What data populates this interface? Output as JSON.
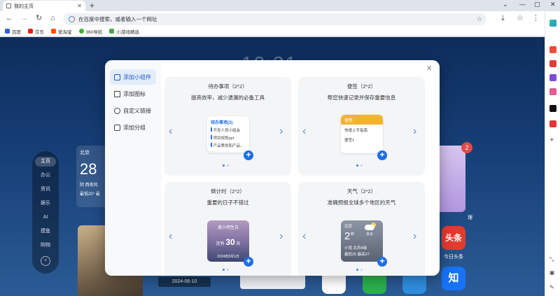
{
  "browser": {
    "tab_title": "我的主页",
    "address_placeholder": "在百度中搜索，或者输入一个网址",
    "bookmarks": [
      "百度",
      "京东",
      "爱淘宝",
      "360导航",
      "小游戏精选"
    ]
  },
  "page": {
    "clock": "10:31",
    "nav": [
      "主页",
      "办公",
      "资讯",
      "娱乐",
      "AI",
      "摸鱼",
      "购物"
    ],
    "weather": {
      "city": "北京",
      "temp": "28",
      "line1": "阴 西南风",
      "line2": "最低20° 最"
    },
    "date_label": "2024-06-10",
    "badge_count": "2",
    "app_labels": {
      "manage": "理",
      "toutiao": "今日头条",
      "toutiao_logo": "头条",
      "zhihu_logo": "知"
    }
  },
  "modal": {
    "menu": [
      {
        "label": "添加小组件",
        "icon": "widget-icon",
        "active": true
      },
      {
        "label": "添加图标",
        "icon": "grid-icon",
        "active": false
      },
      {
        "label": "自定义链接",
        "icon": "link-icon",
        "active": false
      },
      {
        "label": "添加分组",
        "icon": "folder-icon",
        "active": false
      }
    ],
    "cards": {
      "todo": {
        "title": "待办事项（2*2）",
        "desc": "提高效率，减少遗漏的必备工具",
        "preview_header": "待办事项(3)",
        "preview_items": [
          "开发人员小组会",
          "项目规划ppt",
          "产品策划和产品..."
        ]
      },
      "note": {
        "title": "便签（2*2）",
        "desc": "帮您快速记录并保存重要信息",
        "preview_header": "便签",
        "preview_items": [
          "快速上手指南",
          "便签1"
        ]
      },
      "countdown": {
        "title": "倒计时（2*2）",
        "desc": "重要的日子不错过",
        "preview_event": "离小明生日",
        "preview_prefix": "还有",
        "preview_days": "30",
        "preview_unit": "天",
        "preview_date": "2024年8月1日"
      },
      "weather": {
        "title": "天气（2*2）",
        "desc": "准确预报全球多个地区的天气",
        "preview_city": "北京",
        "preview_temp": "2°",
        "preview_cond": "多云",
        "preview_line1": "小雨 北风4级",
        "preview_line2": "最低25 最高27"
      }
    }
  },
  "colors": {
    "accent": "#1f6fe5",
    "note_header": "#f4b32c",
    "badge": "#e24a4a"
  }
}
